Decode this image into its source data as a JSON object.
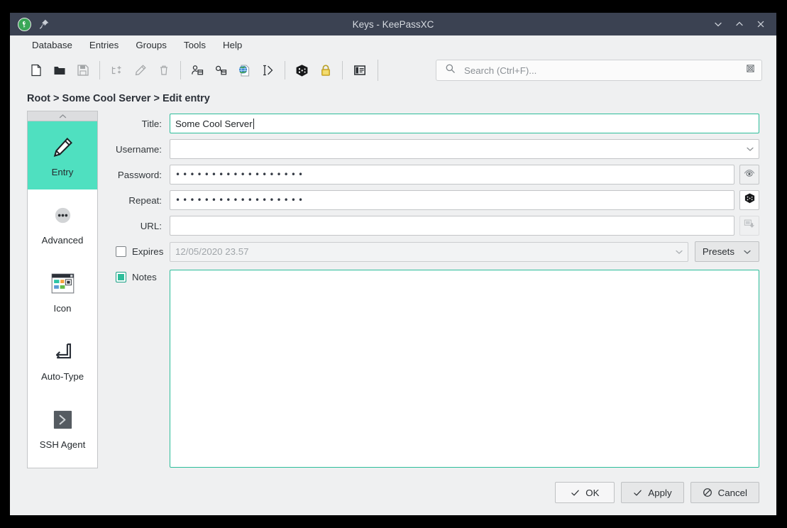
{
  "window": {
    "title": "Keys - KeePassXC",
    "logo_icon": "keepassxc-logo-icon",
    "pin_icon": "pin-icon",
    "controls": [
      {
        "name": "minimize-button",
        "icon": "chevron-down-icon"
      },
      {
        "name": "maximize-button",
        "icon": "chevron-up-icon"
      },
      {
        "name": "close-button",
        "icon": "close-icon"
      }
    ]
  },
  "menubar": {
    "items": [
      {
        "label": "Database"
      },
      {
        "label": "Entries"
      },
      {
        "label": "Groups"
      },
      {
        "label": "Tools"
      },
      {
        "label": "Help"
      }
    ]
  },
  "toolbar": {
    "buttons": [
      {
        "name": "new-database-button",
        "icon": "new-document-icon",
        "enabled": true
      },
      {
        "name": "open-database-button",
        "icon": "folder-open-icon",
        "enabled": true
      },
      {
        "name": "save-database-button",
        "icon": "floppy-save-icon",
        "enabled": false
      },
      {
        "name": "new-entry-button",
        "icon": "add-entry-icon",
        "enabled": false
      },
      {
        "name": "edit-entry-button",
        "icon": "pencil-edit-icon",
        "enabled": false
      },
      {
        "name": "delete-entry-button",
        "icon": "trash-delete-icon",
        "enabled": false
      },
      {
        "name": "copy-username-button",
        "icon": "copy-username-icon",
        "enabled": true
      },
      {
        "name": "copy-password-button",
        "icon": "copy-password-icon",
        "enabled": true
      },
      {
        "name": "open-url-button",
        "icon": "globe-url-icon",
        "enabled": true
      },
      {
        "name": "perform-autotype-button",
        "icon": "autotype-arrow-icon",
        "enabled": true
      },
      {
        "name": "password-generator-button",
        "icon": "dice-icon",
        "enabled": true
      },
      {
        "name": "lock-database-button",
        "icon": "padlock-icon",
        "enabled": true
      },
      {
        "name": "toggle-preview-panel-button",
        "icon": "panel-view-icon",
        "enabled": true
      }
    ]
  },
  "search": {
    "icon": "search-icon",
    "placeholder": "Search (Ctrl+F)...",
    "value": "",
    "options_icon": "search-options-icon"
  },
  "breadcrumb": {
    "text": "Root > Some Cool Server > Edit entry"
  },
  "sidebar": {
    "scroll_up_icon": "chevron-up-icon",
    "items": [
      {
        "label": "Entry",
        "icon": "pencil-icon",
        "selected": true
      },
      {
        "label": "Advanced",
        "icon": "ellipsis-circle-icon",
        "selected": false
      },
      {
        "label": "Icon",
        "icon": "window-icon-grid-icon",
        "selected": false
      },
      {
        "label": "Auto-Type",
        "icon": "enter-key-icon",
        "selected": false
      },
      {
        "label": "SSH Agent",
        "icon": "terminal-prompt-icon",
        "selected": false
      }
    ]
  },
  "form": {
    "title": {
      "label": "Title:",
      "value": "Some Cool Server",
      "focused": true
    },
    "username": {
      "label": "Username:",
      "value": "",
      "dropdown_icon": "chevron-down-icon"
    },
    "password": {
      "label": "Password:",
      "value": "••••••••••••••••••",
      "reveal_button": {
        "name": "toggle-password-visibility-button",
        "icon": "eye-icon"
      }
    },
    "repeat": {
      "label": "Repeat:",
      "value": "••••••••••••••••••",
      "generate_button": {
        "name": "generate-password-button",
        "icon": "dice-icon"
      }
    },
    "url": {
      "label": "URL:",
      "value": "",
      "fetch_button": {
        "name": "download-favicon-button",
        "icon": "download-favicon-icon"
      }
    },
    "expires": {
      "label": "Expires",
      "checked": false,
      "date_value": "12/05/2020 23.57",
      "dropdown_icon": "chevron-down-icon",
      "presets_label": "Presets",
      "presets_icon": "chevron-down-icon"
    },
    "notes": {
      "label": "Notes",
      "checked": true,
      "value": ""
    }
  },
  "footer": {
    "buttons": [
      {
        "label": "OK",
        "icon": "check-icon",
        "name": "ok-button"
      },
      {
        "label": "Apply",
        "icon": "check-icon",
        "name": "apply-button"
      },
      {
        "label": "Cancel",
        "icon": "cancel-circle-icon",
        "name": "cancel-button"
      }
    ]
  },
  "colors": {
    "accent_teal": "#4fe0c0",
    "focus_border": "#2dbd9a",
    "titlebar": "#3b4252",
    "chrome": "#eff0f1"
  }
}
